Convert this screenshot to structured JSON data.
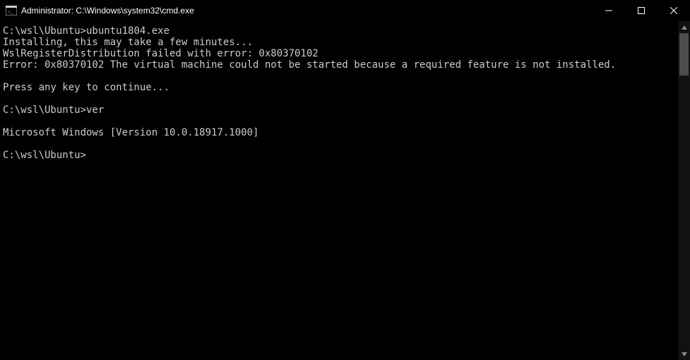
{
  "titlebar": {
    "icon_name": "cmd-icon",
    "title": "Administrator: C:\\Windows\\system32\\cmd.exe"
  },
  "controls": {
    "minimize_name": "minimize-button",
    "maximize_name": "maximize-button",
    "close_name": "close-button"
  },
  "terminal": {
    "lines": [
      "C:\\wsl\\Ubuntu>ubuntu1804.exe",
      "Installing, this may take a few minutes...",
      "WslRegisterDistribution failed with error: 0x80370102",
      "Error: 0x80370102 The virtual machine could not be started because a required feature is not installed.",
      "",
      "Press any key to continue...",
      "",
      "C:\\wsl\\Ubuntu>ver",
      "",
      "Microsoft Windows [Version 10.0.18917.1000]",
      "",
      "C:\\wsl\\Ubuntu>"
    ]
  }
}
